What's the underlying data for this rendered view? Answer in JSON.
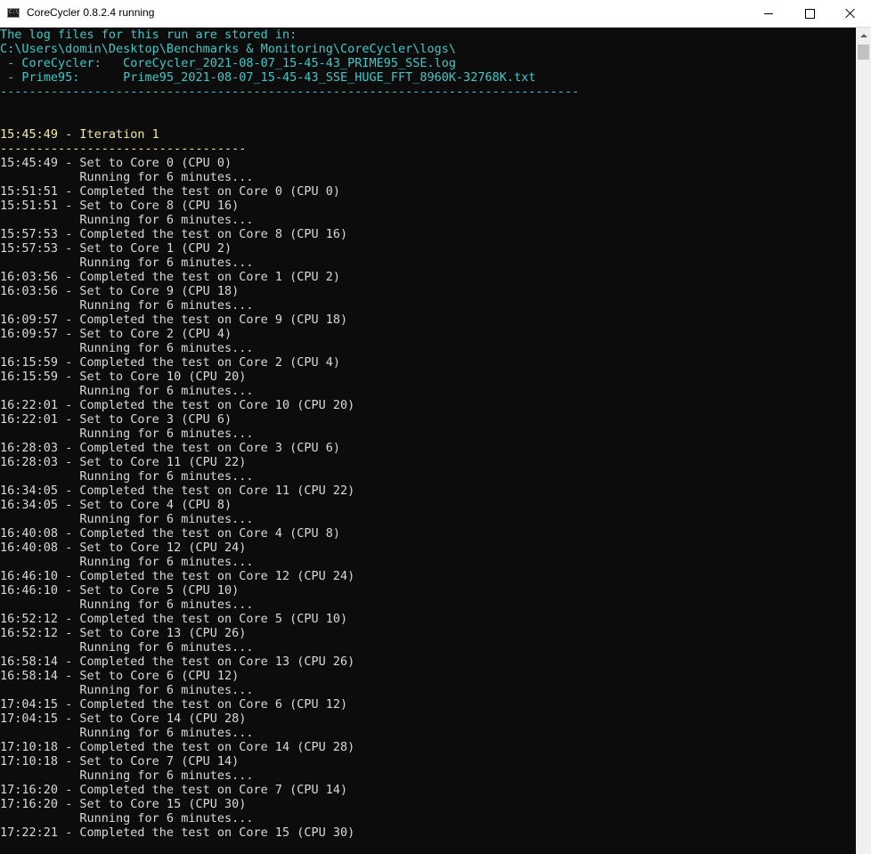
{
  "window": {
    "title": "CoreCycler 0.8.2.4 running",
    "icon_text": "C:\\",
    "icon_name": "console-app-icon"
  },
  "colors": {
    "background": "#0c0c0c",
    "info_text": "#3fc8c8",
    "normal_text": "#d9d9d9",
    "iteration_text": "#f2e9a4"
  },
  "header": {
    "line1": "The log files for this run are stored in:",
    "line2": "C:\\Users\\domin\\Desktop\\Benchmarks & Monitoring\\CoreCycler\\logs\\",
    "line3": " - CoreCycler:   CoreCycler_2021-08-07_15-45-43_PRIME95_SSE.log",
    "line4": " - Prime95:      Prime95_2021-08-07_15-45-43_SSE_HUGE_FFT_8960K-32768K.txt",
    "separator": "--------------------------------------------------------------------------------"
  },
  "iteration": {
    "title": "15:45:49 - Iteration 1",
    "separator": "----------------------------------"
  },
  "log": [
    "15:45:49 - Set to Core 0 (CPU 0)",
    "           Running for 6 minutes...",
    "15:51:51 - Completed the test on Core 0 (CPU 0)",
    "15:51:51 - Set to Core 8 (CPU 16)",
    "           Running for 6 minutes...",
    "15:57:53 - Completed the test on Core 8 (CPU 16)",
    "15:57:53 - Set to Core 1 (CPU 2)",
    "           Running for 6 minutes...",
    "16:03:56 - Completed the test on Core 1 (CPU 2)",
    "16:03:56 - Set to Core 9 (CPU 18)",
    "           Running for 6 minutes...",
    "16:09:57 - Completed the test on Core 9 (CPU 18)",
    "16:09:57 - Set to Core 2 (CPU 4)",
    "           Running for 6 minutes...",
    "16:15:59 - Completed the test on Core 2 (CPU 4)",
    "16:15:59 - Set to Core 10 (CPU 20)",
    "           Running for 6 minutes...",
    "16:22:01 - Completed the test on Core 10 (CPU 20)",
    "16:22:01 - Set to Core 3 (CPU 6)",
    "           Running for 6 minutes...",
    "16:28:03 - Completed the test on Core 3 (CPU 6)",
    "16:28:03 - Set to Core 11 (CPU 22)",
    "           Running for 6 minutes...",
    "16:34:05 - Completed the test on Core 11 (CPU 22)",
    "16:34:05 - Set to Core 4 (CPU 8)",
    "           Running for 6 minutes...",
    "16:40:08 - Completed the test on Core 4 (CPU 8)",
    "16:40:08 - Set to Core 12 (CPU 24)",
    "           Running for 6 minutes...",
    "16:46:10 - Completed the test on Core 12 (CPU 24)",
    "16:46:10 - Set to Core 5 (CPU 10)",
    "           Running for 6 minutes...",
    "16:52:12 - Completed the test on Core 5 (CPU 10)",
    "16:52:12 - Set to Core 13 (CPU 26)",
    "           Running for 6 minutes...",
    "16:58:14 - Completed the test on Core 13 (CPU 26)",
    "16:58:14 - Set to Core 6 (CPU 12)",
    "           Running for 6 minutes...",
    "17:04:15 - Completed the test on Core 6 (CPU 12)",
    "17:04:15 - Set to Core 14 (CPU 28)",
    "           Running for 6 minutes...",
    "17:10:18 - Completed the test on Core 14 (CPU 28)",
    "17:10:18 - Set to Core 7 (CPU 14)",
    "           Running for 6 minutes...",
    "17:16:20 - Completed the test on Core 7 (CPU 14)",
    "17:16:20 - Set to Core 15 (CPU 30)",
    "           Running for 6 minutes...",
    "17:22:21 - Completed the test on Core 15 (CPU 30)"
  ]
}
